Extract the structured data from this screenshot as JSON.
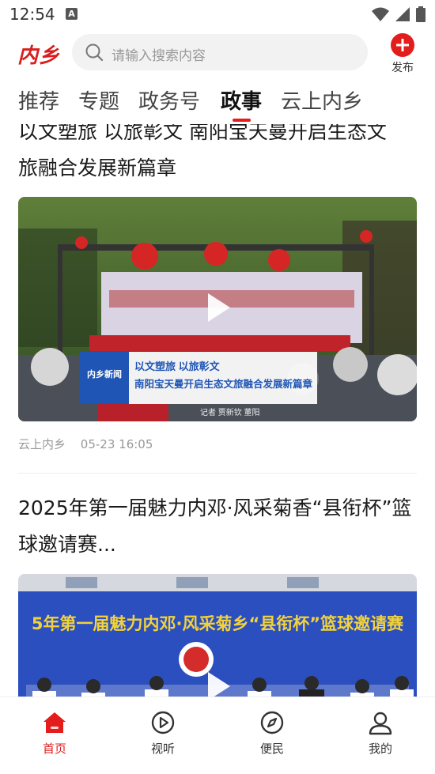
{
  "status_bar": {
    "time": "12:54",
    "notification_letter": "A"
  },
  "header": {
    "logo": "内乡",
    "search": {
      "placeholder": "请输入搜索内容"
    },
    "publish_label": "发布"
  },
  "tabs": [
    {
      "label": "推荐",
      "active": false
    },
    {
      "label": "专题",
      "active": false
    },
    {
      "label": "政务号",
      "active": false
    },
    {
      "label": "政事",
      "active": true
    },
    {
      "label": "云上内乡",
      "active": false
    }
  ],
  "articles": [
    {
      "title_line1": "以文塑旅 以旅彰文 南阳宝天曼开启生态文",
      "title_line2": "旅融合发展新篇章",
      "video_overlay": {
        "badge": "内乡新闻",
        "line1": "以文塑旅  以旅彰文",
        "line2": "南阳宝天曼开启生态文旅融合发展新篇章",
        "reporter": "记者  贾新钦  董阳"
      },
      "source": "云上内乡",
      "time": "05-23 16:05"
    },
    {
      "title_line1": "2025年第一届魅力内邓·风采菊香“县衔杯”篮",
      "title_line2": "球邀请赛...",
      "banner_text": "5年第一届魅力内邓·风采菊乡“县衔杯”篮球邀请赛"
    }
  ],
  "bottom_nav": [
    {
      "label": "首页",
      "icon": "home-icon",
      "active": true
    },
    {
      "label": "视听",
      "icon": "play-circle-icon",
      "active": false
    },
    {
      "label": "便民",
      "icon": "compass-icon",
      "active": false
    },
    {
      "label": "我的",
      "icon": "user-icon",
      "active": false
    }
  ],
  "colors": {
    "accent": "#e31c1c",
    "logo": "#d81e1e",
    "banner_blue": "#2c4fbf"
  }
}
